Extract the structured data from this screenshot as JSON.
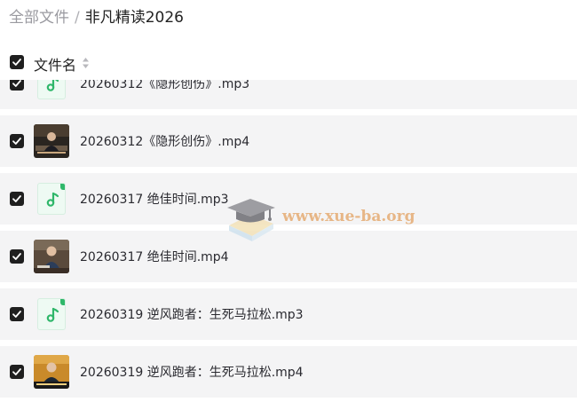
{
  "breadcrumb": {
    "root": "全部文件",
    "separator": "/",
    "current": "非凡精读2026"
  },
  "header": {
    "select_all_checked": true,
    "column_label": "文件名",
    "sort_icon": "sort-icon"
  },
  "files": [
    {
      "name": "20260312《隐形创伤》.mp3",
      "type": "audio",
      "checked": true
    },
    {
      "name": "20260312《隐形创伤》.mp4",
      "type": "video",
      "checked": true
    },
    {
      "name": "20260317 绝佳时间.mp3",
      "type": "audio",
      "checked": true
    },
    {
      "name": "20260317 绝佳时间.mp4",
      "type": "video",
      "checked": true
    },
    {
      "name": "20260319 逆风跑者：生死马拉松.mp3",
      "type": "audio",
      "checked": true
    },
    {
      "name": "20260319 逆风跑者：生死马拉松.mp4",
      "type": "video",
      "checked": true
    }
  ],
  "watermark": {
    "text": "www.xue-ba.org",
    "icon": "graduation-cap-icon"
  },
  "colors": {
    "checkbox": "#1f1f1f",
    "row_background": "#f4f4f5",
    "audio_icon": "#2fb76a",
    "watermark": "#e6b07a"
  }
}
